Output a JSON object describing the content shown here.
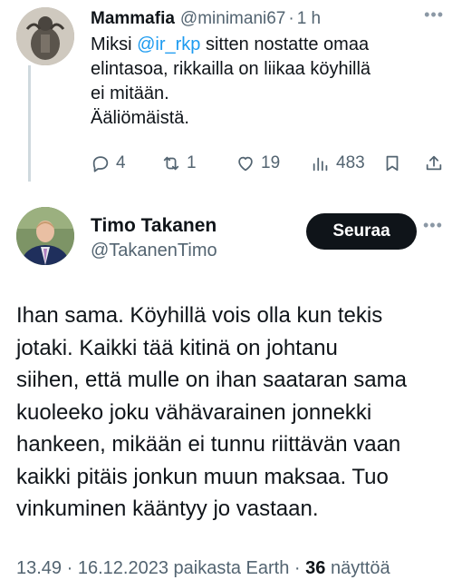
{
  "reply": {
    "name": "Mammafia",
    "handle": "@minimani67",
    "separator": "·",
    "time": "1 h",
    "more_icon": "more-icon",
    "text_lines": [
      {
        "mention": "Miksi ",
        "tag": "@ir_rkp",
        "rest": " sitten nostatte omaa"
      },
      "elintasoa, rikkailla on liikaa köyhillä",
      "ei mitään.",
      "Ääliömäistä."
    ],
    "actions": {
      "replies": "4",
      "reposts": "1",
      "likes": "19",
      "views": "483"
    }
  },
  "tweet": {
    "name": "Timo Takanen",
    "handle": "@TakanenTimo",
    "follow_label": "Seuraa",
    "text_lines": [
      "Ihan sama. Köyhillä vois olla kun tekis",
      "jotaki. Kaikki tää kitinä on johtanu",
      "siihen, että mulle on ihan saataran sama",
      "kuoleeko joku vähävarainen jonnekki",
      "hankeen, mikään ei tunnu riittävän vaan",
      "kaikki pitäis jonkun muun maksaa. Tuo",
      "vinkuminen kääntyy jo vastaan."
    ],
    "meta": {
      "time": "13.49",
      "sep1": " · ",
      "date": "16.12.2023",
      "source": " paikasta Earth",
      "sep2": " · ",
      "views_count": "36",
      "views_label": " näyttöä"
    }
  },
  "colors": {
    "text": "#0f1419",
    "secondary": "#536471",
    "link": "#1d9bf0",
    "button_bg": "#0f1419",
    "thread_line": "#cfd9de"
  }
}
